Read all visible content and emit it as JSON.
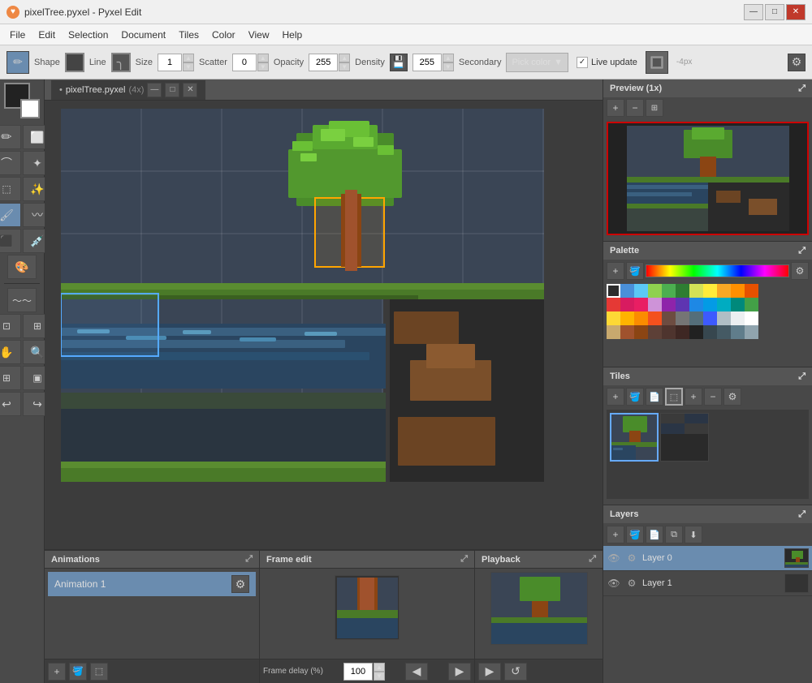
{
  "titlebar": {
    "title": "pixelTree.pyxel - Pyxel Edit",
    "icon": "♥",
    "controls": [
      "—",
      "□",
      "✕"
    ]
  },
  "menu": {
    "items": [
      "File",
      "Edit",
      "Selection",
      "Document",
      "Tiles",
      "Color",
      "View",
      "Help"
    ]
  },
  "toolbar": {
    "shape_label": "Shape",
    "line_label": "Line",
    "size_label": "Size",
    "size_value": "1",
    "scatter_label": "Scatter",
    "scatter_value": "0",
    "opacity_label": "Opacity",
    "opacity_value": "255",
    "density_label": "Density",
    "density_value": "255",
    "secondary_label": "Secondary",
    "pick_color_label": "Pick color",
    "live_update_label": "Live update"
  },
  "canvas": {
    "tab_title": "pixelTree.pyxel",
    "zoom": "(4x)"
  },
  "right_panel": {
    "preview_title": "Preview (1x)",
    "palette_title": "Palette",
    "tiles_title": "Tiles",
    "layers_title": "Layers"
  },
  "palette": {
    "colors": [
      [
        "#2c2c2c",
        "#1a1a2e",
        "#4a90d9",
        "#5bc8f5",
        "#8fd14f",
        "#4caf50",
        "#2e7d32",
        "#d4e157",
        "#ffeb3b",
        "#f9a825",
        "#ff8f00"
      ],
      [
        "#e53935",
        "#d81b60",
        "#8e24aa",
        "#5e35b1",
        "#1e88e5",
        "#039be5",
        "#00acc1",
        "#00897b",
        "#43a047",
        "#7cb342",
        "#c0ca33"
      ],
      [
        "#fdd835",
        "#ffb300",
        "#fb8c00",
        "#f4511e",
        "#6d4c41",
        "#757575",
        "#546e7a",
        "#3d5afe",
        "#b0bec5",
        "#eceff1",
        "#ffffff"
      ],
      [
        "#c8a96e",
        "#a0522d",
        "#8b4513",
        "#5d4037",
        "#4e342e",
        "#3e2723",
        "#212121",
        "#37474f",
        "#455a64",
        "#607d8b",
        "#90a4ae"
      ]
    ]
  },
  "layers": {
    "items": [
      {
        "name": "Layer 0",
        "visible": true,
        "selected": true
      },
      {
        "name": "Layer 1",
        "visible": true,
        "selected": false
      }
    ]
  },
  "animations": {
    "items": [
      {
        "name": "Animation 1",
        "selected": true
      }
    ]
  },
  "frame_edit": {
    "title": "Frame edit",
    "delay_label": "Frame delay (%)",
    "delay_value": "100"
  },
  "playback": {
    "title": "Playback"
  },
  "icons": {
    "plus": "+",
    "bucket": "🪣",
    "new": "📄",
    "copy": "⧉",
    "zoom_in": "🔍+",
    "zoom_out": "🔍-",
    "gear": "⚙",
    "eye": "👁",
    "prev": "◀",
    "next": "▶",
    "play": "▶",
    "reset": "↺",
    "expand": "⤢",
    "move_up": "⬆",
    "move_down": "⬇"
  }
}
